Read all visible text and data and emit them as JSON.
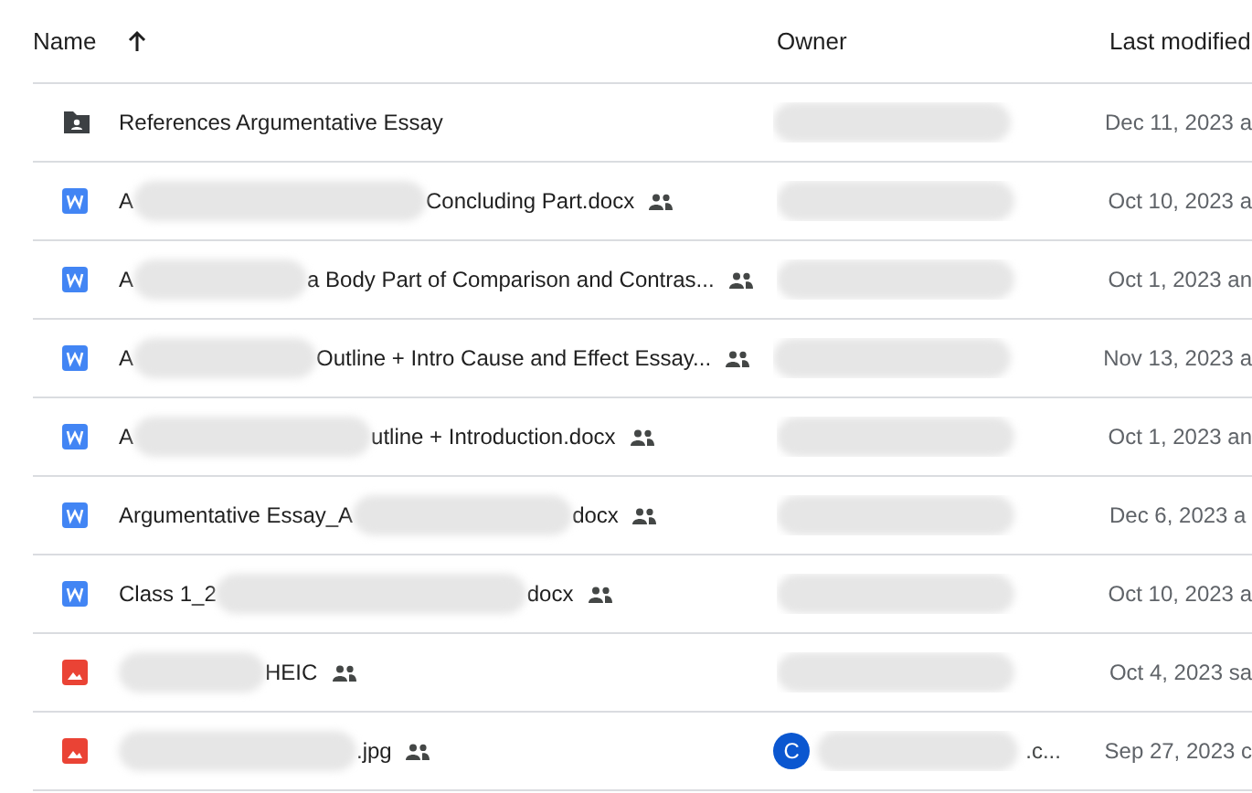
{
  "columns": [
    {
      "label": "Name",
      "sort_icon": true
    },
    {
      "label": "Owner"
    },
    {
      "label": "Last modified"
    }
  ],
  "rows": [
    {
      "kind": "folder",
      "name_parts": [
        {
          "kind": "text",
          "text": "References Argumentative Essay"
        }
      ],
      "shared": false,
      "modified": "Dec 11, 2023 a"
    },
    {
      "kind": "doc",
      "name_parts": [
        {
          "kind": "text",
          "text": "A"
        },
        {
          "kind": "blur"
        },
        {
          "kind": "text",
          "text": "Concluding Part.docx"
        }
      ],
      "shared": true,
      "modified": "Oct 10, 2023 a"
    },
    {
      "kind": "doc",
      "name_parts": [
        {
          "kind": "text",
          "text": "A"
        },
        {
          "kind": "blur"
        },
        {
          "kind": "text",
          "text": "a Body Part of Comparison and Contras..."
        }
      ],
      "shared": true,
      "modified": "Oct 1, 2023 an"
    },
    {
      "kind": "doc",
      "name_parts": [
        {
          "kind": "text",
          "text": "A"
        },
        {
          "kind": "blur"
        },
        {
          "kind": "text",
          "text": "Outline + Intro Cause and Effect Essay..."
        }
      ],
      "shared": true,
      "modified": "Nov 13, 2023 a"
    },
    {
      "kind": "doc",
      "name_parts": [
        {
          "kind": "text",
          "text": "A"
        },
        {
          "kind": "blur"
        },
        {
          "kind": "text",
          "text": "utline + Introduction.docx"
        }
      ],
      "shared": true,
      "modified": "Oct 1, 2023 an"
    },
    {
      "kind": "doc",
      "name_parts": [
        {
          "kind": "text",
          "text": "Argumentative Essay_A"
        },
        {
          "kind": "blur"
        },
        {
          "kind": "text",
          "text": "docx"
        }
      ],
      "shared": true,
      "modified": "Dec 6, 2023 a"
    },
    {
      "kind": "doc",
      "name_parts": [
        {
          "kind": "text",
          "text": "Class 1_2"
        },
        {
          "kind": "blur"
        },
        {
          "kind": "text",
          "text": "docx"
        }
      ],
      "shared": true,
      "modified": "Oct 10, 2023 a"
    },
    {
      "kind": "image",
      "name_parts": [
        {
          "kind": "blur"
        },
        {
          "kind": "text",
          "text": "HEIC"
        }
      ],
      "shared": true,
      "modified": "Oct 4, 2023 sa"
    },
    {
      "kind": "image",
      "name_parts": [
        {
          "kind": "blur"
        },
        {
          "kind": "text",
          "text": ".jpg"
        }
      ],
      "shared": true,
      "owner_avatar": "C",
      "owner_end": ".c...",
      "modified": "Sep 27, 2023 c"
    }
  ]
}
